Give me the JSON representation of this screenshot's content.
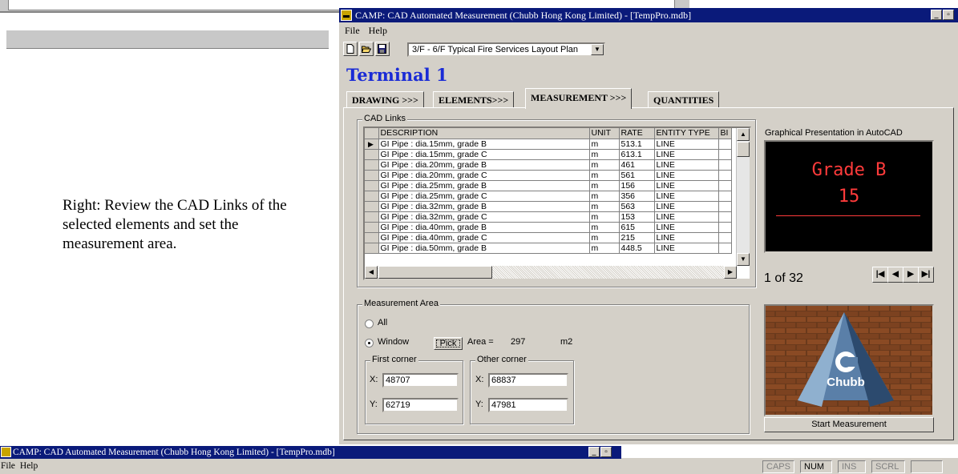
{
  "caption": "Right: Review the CAD Links of the selected elements and set the measurement area.",
  "window": {
    "title": "CAMP: CAD Automated Measurement (Chubb Hong Kong Limited) - [TempPro.mdb]",
    "menu": [
      "File",
      "Help"
    ],
    "drawing_select": "3/F - 6/F Typical Fire Services Layout Plan"
  },
  "heading": "Terminal 1",
  "tabs": [
    "DRAWING >>>",
    "ELEMENTS>>>",
    "MEASUREMENT >>>",
    "QUANTITIES"
  ],
  "active_tab": "MEASUREMENT >>>",
  "cad_links": {
    "label": "CAD Links",
    "columns": [
      "DESCRIPTION",
      "UNIT",
      "RATE",
      "ENTITY TYPE",
      "BI"
    ],
    "rows": [
      {
        "desc": "GI Pipe : dia.15mm, grade B",
        "unit": "m",
        "rate": "513.1",
        "type": "LINE"
      },
      {
        "desc": "GI Pipe : dia.15mm, grade C",
        "unit": "m",
        "rate": "613.1",
        "type": "LINE"
      },
      {
        "desc": "GI Pipe : dia.20mm, grade B",
        "unit": "m",
        "rate": "461",
        "type": "LINE"
      },
      {
        "desc": "GI Pipe : dia.20mm, grade C",
        "unit": "m",
        "rate": "561",
        "type": "LINE"
      },
      {
        "desc": "GI Pipe : dia.25mm, grade B",
        "unit": "m",
        "rate": "156",
        "type": "LINE"
      },
      {
        "desc": "GI Pipe : dia.25mm, grade C",
        "unit": "m",
        "rate": "356",
        "type": "LINE"
      },
      {
        "desc": "GI Pipe : dia.32mm, grade B",
        "unit": "m",
        "rate": "563",
        "type": "LINE"
      },
      {
        "desc": "GI Pipe : dia.32mm, grade C",
        "unit": "m",
        "rate": "153",
        "type": "LINE"
      },
      {
        "desc": "GI Pipe : dia.40mm, grade B",
        "unit": "m",
        "rate": "615",
        "type": "LINE"
      },
      {
        "desc": "GI Pipe : dia.40mm, grade C",
        "unit": "m",
        "rate": "215",
        "type": "LINE"
      },
      {
        "desc": "GI Pipe : dia.50mm, grade B",
        "unit": "m",
        "rate": "448.5",
        "type": "LINE"
      }
    ]
  },
  "preview": {
    "label": "Graphical Presentation in AutoCAD",
    "line1": "Grade B",
    "line2": "15",
    "text_color": "#ff3b3b",
    "counter": "1 of 32"
  },
  "measurement_area": {
    "label": "Measurement Area",
    "option_all": "All",
    "option_window": "Window",
    "selected": "Window",
    "pick_label": "Pick",
    "area_label": "Area =",
    "area_value": "297",
    "area_unit": "m2",
    "first_corner": {
      "label": "First corner",
      "x_label": "X:",
      "x": "48707",
      "y_label": "Y:",
      "y": "62719"
    },
    "other_corner": {
      "label": "Other corner",
      "x_label": "X:",
      "x": "68837",
      "y_label": "Y:",
      "y": "47981"
    }
  },
  "logo_text": "Chubb",
  "start_button": "Start Measurement",
  "status": {
    "caps": "CAPS",
    "num": "NUM",
    "ins": "INS",
    "scrl": "SCRL"
  },
  "colors": {
    "title_bar": "#0a1a7a",
    "heading": "#1a2bd6",
    "face": "#d4d0c8"
  },
  "icons": [
    "new-file-icon",
    "open-folder-icon",
    "save-icon",
    "first-record-icon",
    "prev-record-icon",
    "next-record-icon",
    "last-record-icon"
  ]
}
